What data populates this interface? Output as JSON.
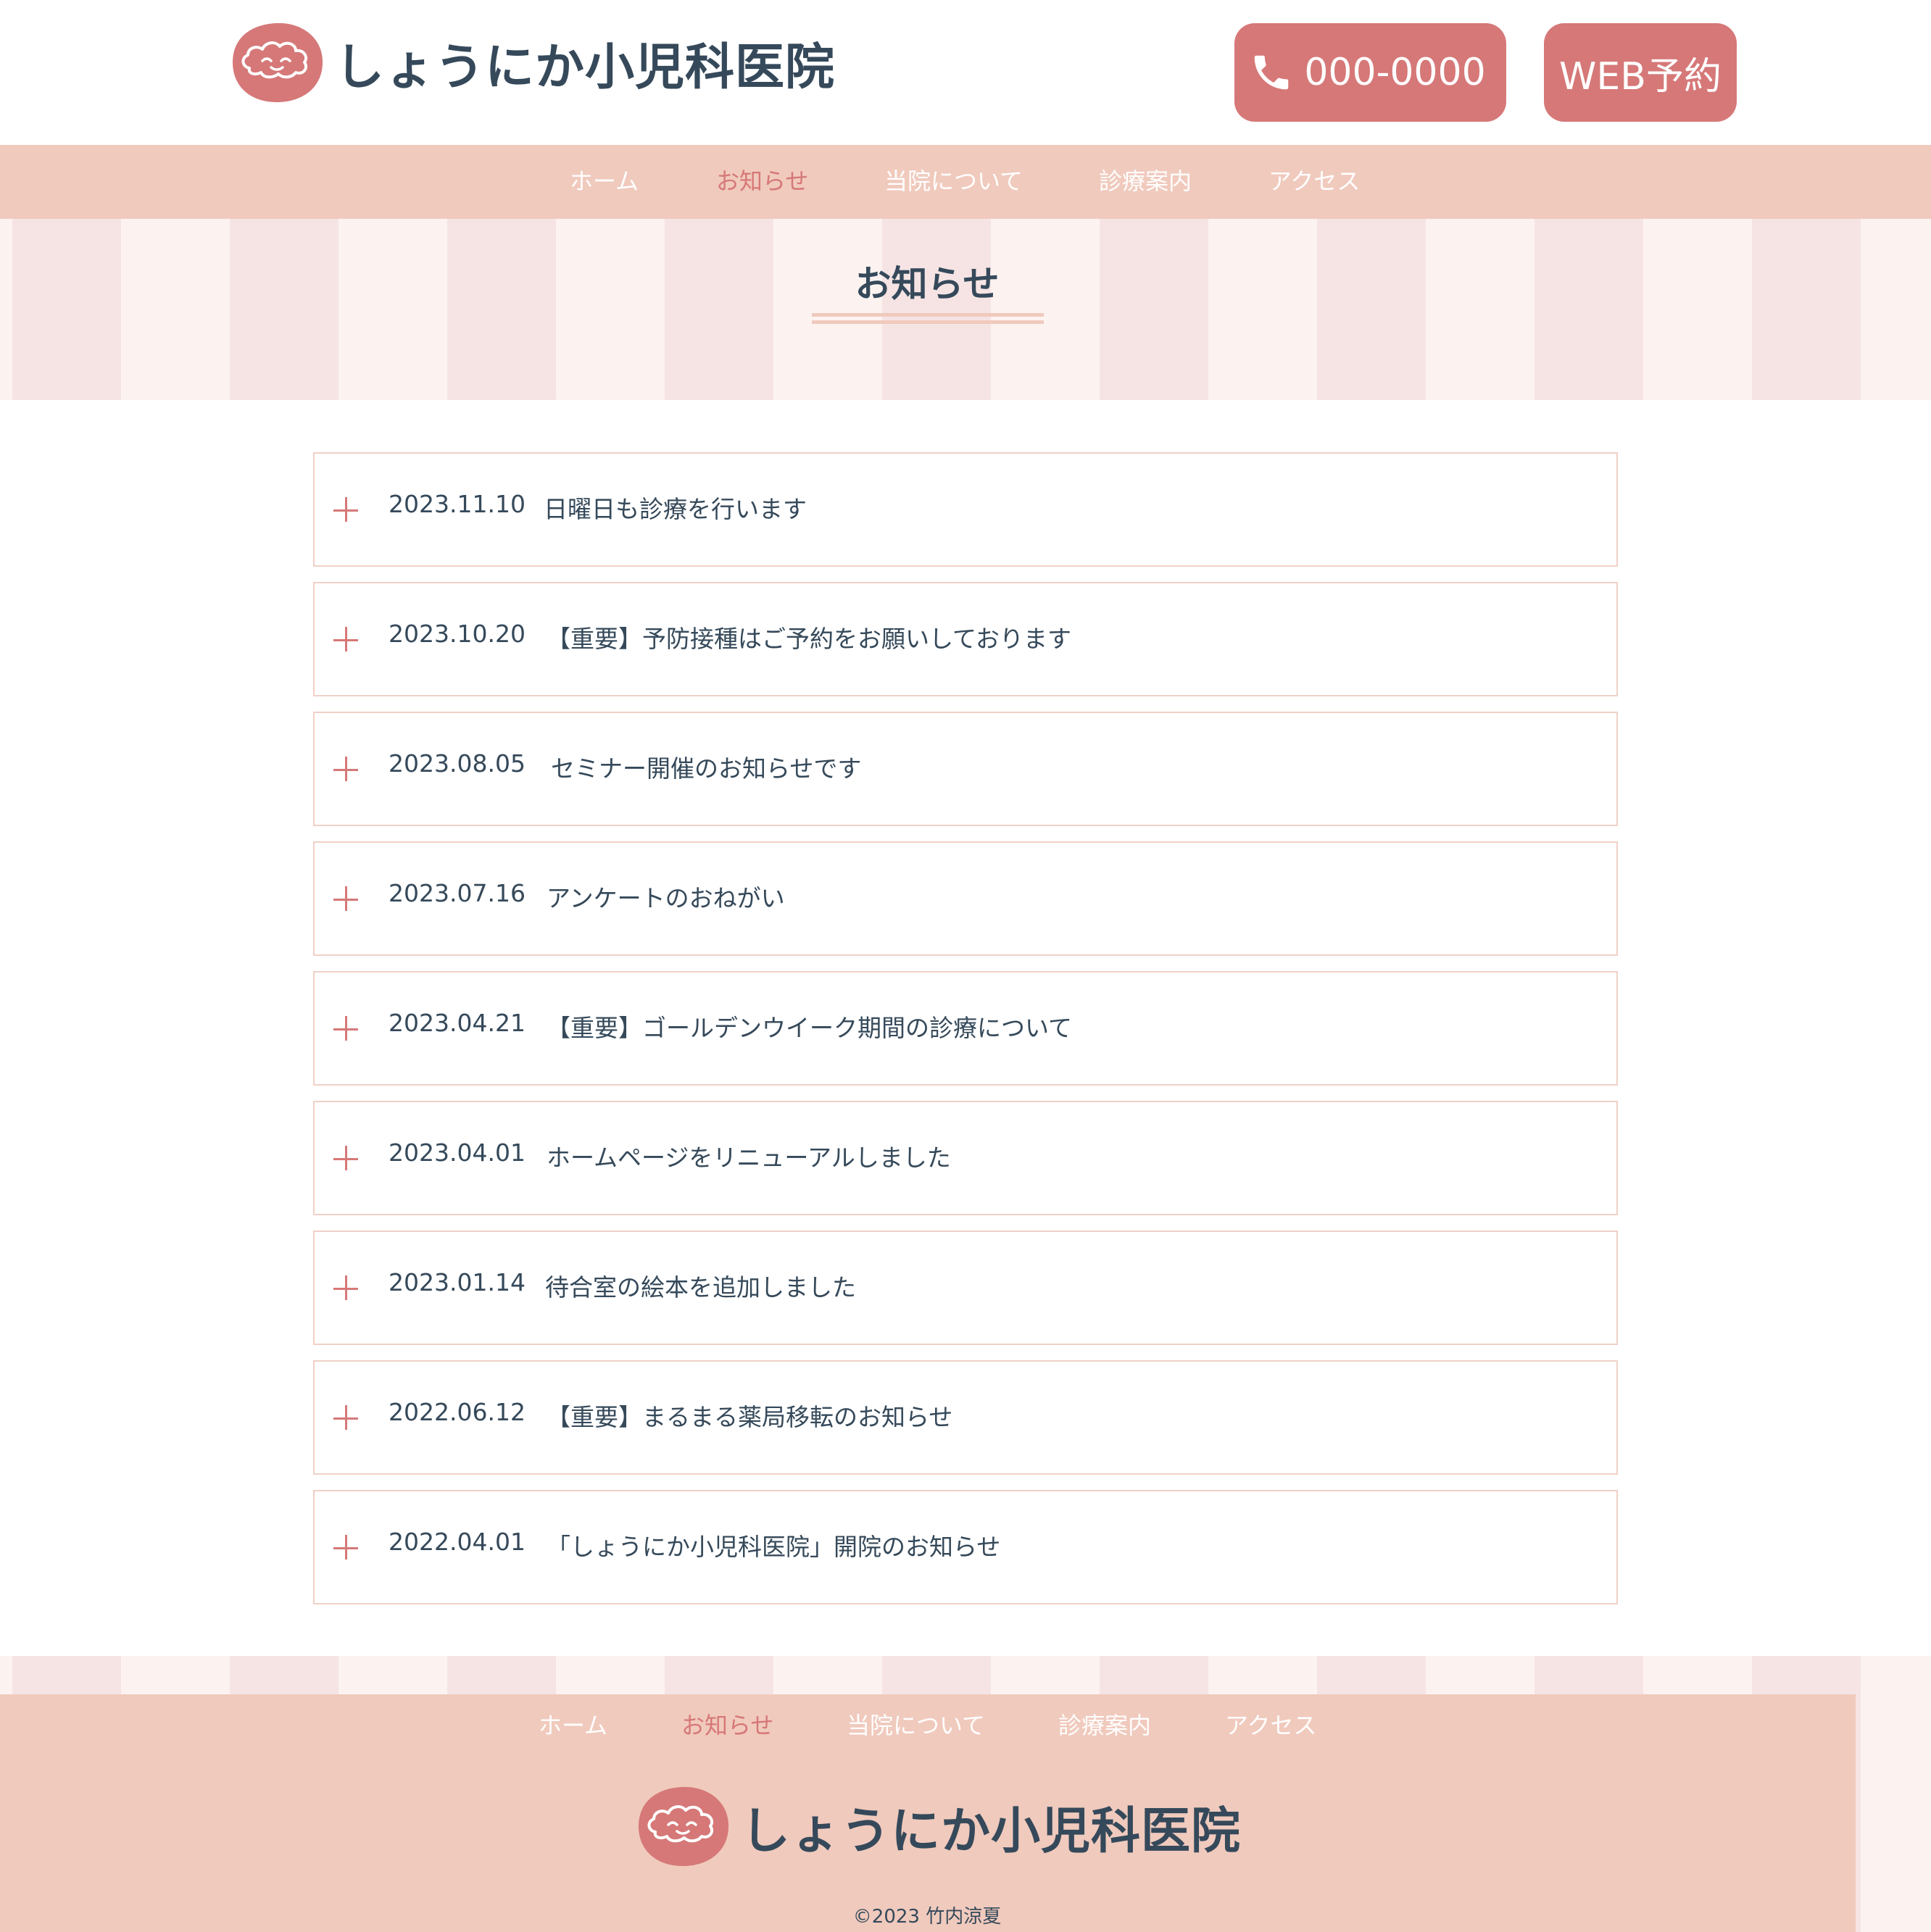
{
  "header": {
    "site_name": "しょうにか小児科医院",
    "logo_icon": "cloud-face-logo-icon",
    "tel_label": "000-0000",
    "tel_icon": "phone-icon",
    "web_label": "WEB予約"
  },
  "nav": {
    "items": [
      {
        "label": "ホーム"
      },
      {
        "label": "お知らせ",
        "active": true
      },
      {
        "label": "当院について"
      },
      {
        "label": "診療案内"
      },
      {
        "label": "アクセス"
      }
    ]
  },
  "page": {
    "title": "お知らせ"
  },
  "news": {
    "expand_icon": "plus-icon",
    "items": [
      {
        "date": "2023.11.10",
        "title": "日曜日も診療を行います"
      },
      {
        "date": "2023.10.20",
        "title": "【重要】予防接種はご予約をお願いしております"
      },
      {
        "date": "2023.08.05",
        "title": "セミナー開催のお知らせです"
      },
      {
        "date": "2023.07.16",
        "title": "アンケートのおねがい"
      },
      {
        "date": "2023.04.21",
        "title": "【重要】ゴールデンウイーク期間の診療について"
      },
      {
        "date": "2023.04.01",
        "title": "ホームページをリニューアルしました"
      },
      {
        "date": "2023.01.14",
        "title": "待合室の絵本を追加しました"
      },
      {
        "date": "2022.06.12",
        "title": "【重要】まるまる薬局移転のお知らせ"
      },
      {
        "date": "2022.04.01",
        "title": "「しょうにか小児科医院」開院のお知らせ"
      }
    ]
  },
  "footer": {
    "nav_items": [
      {
        "label": "ホーム"
      },
      {
        "label": "お知らせ",
        "active": true
      },
      {
        "label": "当院について"
      },
      {
        "label": "診療案内"
      },
      {
        "label": "アクセス"
      }
    ],
    "site_name": "しょうにか小児科医院",
    "copyright": "©2023 竹内涼夏"
  },
  "colors": {
    "accent": "#d67878",
    "nav_bg": "#f0cabd",
    "text": "#35495a",
    "stripe_light": "#fcf3f1",
    "stripe_dark": "#f6e4e4",
    "card_border": "#f1d0c6"
  }
}
